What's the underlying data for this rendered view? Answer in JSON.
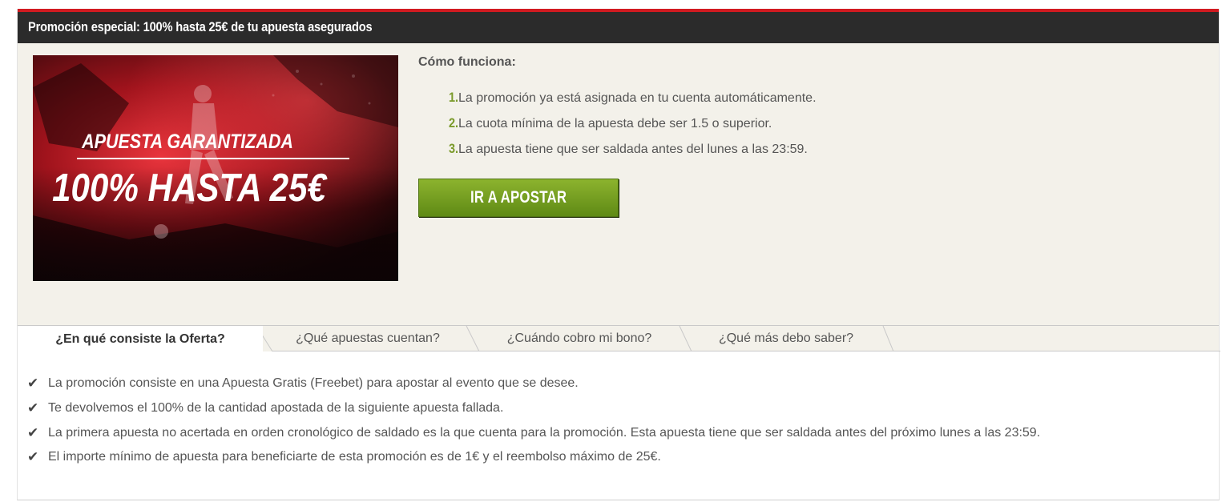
{
  "header": {
    "title": "Promoción especial: 100% hasta 25€ de tu apuesta asegurados"
  },
  "banner": {
    "line1": "APUESTA GARANTIZADA",
    "line2": "100% HASTA 25€"
  },
  "how": {
    "title": "Cómo funciona:",
    "steps": [
      {
        "num": "1.",
        "text": "La promoción ya está asignada en tu cuenta automáticamente."
      },
      {
        "num": "2.",
        "text": "La cuota mínima de la apuesta debe ser 1.5 o superior."
      },
      {
        "num": "3.",
        "text": "La apuesta tiene que ser saldada antes del lunes a las 23:59."
      }
    ],
    "cta_label": "IR A APOSTAR"
  },
  "tabs": [
    {
      "label": "¿En qué consiste la Oferta?",
      "active": true
    },
    {
      "label": "¿Qué apuestas cuentan?",
      "active": false
    },
    {
      "label": "¿Cuándo cobro mi bono?",
      "active": false
    },
    {
      "label": "¿Qué más debo saber?",
      "active": false
    }
  ],
  "features": [
    {
      "icon": "checkmark-icon",
      "text": "La promoción consiste en una Apuesta Gratis (Freebet) para apostar al evento que se desee."
    },
    {
      "icon": "checkmark-icon",
      "text": "Te devolvemos el 100% de la cantidad apostada de la siguiente apuesta fallada."
    },
    {
      "icon": "checkmark-icon",
      "text": "La primera apuesta no acertada en orden cronológico de saldado es la que cuenta para la promoción. Esta apuesta tiene que ser saldada antes del próximo lunes a las 23:59."
    },
    {
      "icon": "checkmark-icon",
      "text": "El importe mínimo de apuesta para beneficiarte de esta promoción es de 1€ y el reembolso máximo de 25€."
    }
  ],
  "colors": {
    "accent_red": "#d11b21",
    "header_bg": "#2b2b2b",
    "cta_green": "#6e9a1e",
    "step_number": "#7a9a2a",
    "panel_bg": "#f3f1ea"
  }
}
